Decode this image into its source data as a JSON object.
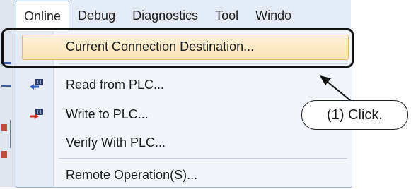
{
  "menubar": {
    "items": [
      "Online",
      "Debug",
      "Diagnostics",
      "Tool",
      "Windo"
    ]
  },
  "dropdown": {
    "items": [
      {
        "label": "Current Connection Destination...",
        "icon": "none"
      },
      {
        "label": "Read from PLC...",
        "icon": "read-from-plc-icon"
      },
      {
        "label": "Write to PLC...",
        "icon": "write-to-plc-icon"
      },
      {
        "label": "Verify With PLC...",
        "icon": "none"
      },
      {
        "label": "Remote Operation(S)...",
        "icon": "none"
      }
    ]
  },
  "callout": {
    "text": "(1) Click."
  },
  "colors": {
    "highlight": "#fbe3b3",
    "menubar": "#e3ebf6",
    "outline": "#111111"
  }
}
